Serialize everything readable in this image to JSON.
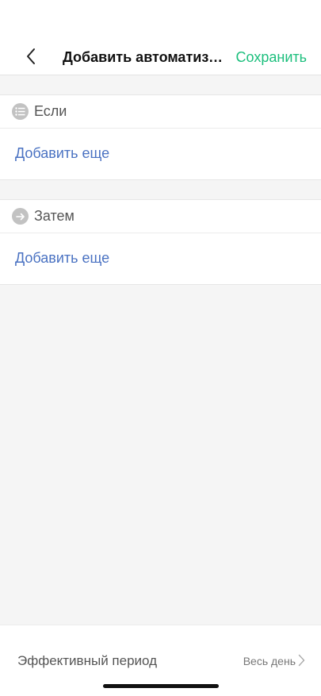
{
  "header": {
    "title": "Добавить автоматизацию",
    "save_label": "Сохранить",
    "back_icon": "chevron-left-icon"
  },
  "sections": {
    "if": {
      "title": "Если",
      "icon": "list-icon",
      "add_label": "Добавить еще"
    },
    "then": {
      "title": "Затем",
      "icon": "arrow-right-icon",
      "add_label": "Добавить еще"
    }
  },
  "footer": {
    "period_label": "Эффективный период",
    "period_value": "Весь день",
    "chevron_icon": "chevron-right-icon"
  },
  "colors": {
    "accent_green": "#1cbf7d",
    "link_blue": "#4a72c2",
    "background": "#f5f5f5",
    "icon_gray": "#c2c2c2"
  }
}
